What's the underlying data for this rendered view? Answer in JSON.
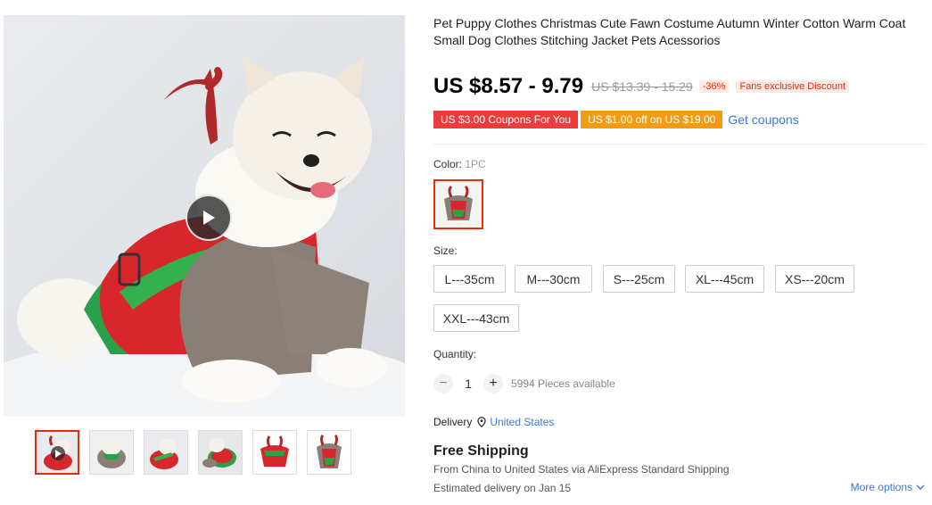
{
  "product": {
    "title": "Pet Puppy Clothes Christmas Cute Fawn Costume Autumn Winter Cotton Warm Coat Small Dog Clothes Stitching Jacket Pets Acessorios"
  },
  "pricing": {
    "price": "US $8.57 - 9.79",
    "original_price": "US $13.39 - 15.29",
    "discount": "-36%",
    "fans_discount": "Fans exclusive Discount"
  },
  "coupons": {
    "coupon1": "US $3.00 Coupons For You",
    "coupon2": "US $1.00 off on US $19.00",
    "get_coupons": "Get coupons"
  },
  "color": {
    "label": "Color:",
    "selected": "1PC"
  },
  "size": {
    "label": "Size:",
    "options": [
      "L---35cm",
      "M---30cm",
      "S---25cm",
      "XL---45cm",
      "XS---20cm",
      "XXL---43cm"
    ]
  },
  "quantity": {
    "label": "Quantity:",
    "minus": "−",
    "value": "1",
    "plus": "+",
    "available": "5994 Pieces available"
  },
  "delivery": {
    "label": "Delivery",
    "country": "United States",
    "free_shipping": "Free Shipping",
    "route": "From China to United States via AliExpress Standard Shipping",
    "estimated": "Estimated delivery on Jan 15",
    "more_options": "More options"
  },
  "colors": {
    "accent": "#e62e04",
    "link": "#3a7bd5",
    "coupon_red": "#ee3b3b",
    "coupon_orange": "#f39c12"
  },
  "icons": {
    "play": "play-icon",
    "location": "location-pin-icon",
    "chevron": "chevron-down-icon"
  }
}
